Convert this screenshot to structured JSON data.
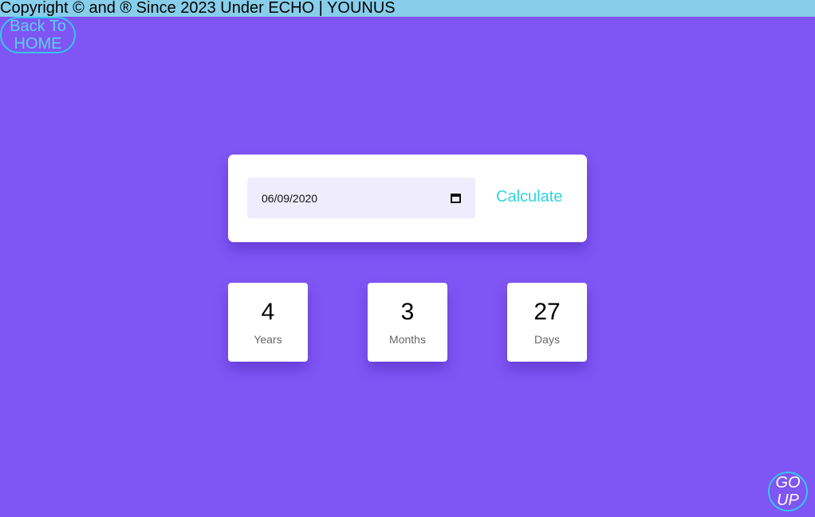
{
  "footer": {
    "copyright": "Copyright © and ® Since 2023 Under ECHO | YOUNUS"
  },
  "nav": {
    "back_line1": "Back To",
    "back_line2": "HOME"
  },
  "calculator": {
    "date_value": "06/09/2020",
    "calculate_label": "Calculate",
    "icon": "calendar-icon"
  },
  "results": {
    "years": {
      "value": "4",
      "label": "Years"
    },
    "months": {
      "value": "3",
      "label": "Months"
    },
    "days": {
      "value": "27",
      "label": "Days"
    }
  },
  "scroll": {
    "line1": "GO",
    "line2": "UP"
  },
  "colors": {
    "background": "#7f55f4",
    "topbar": "#87ceeb",
    "accent": "#2fd5e0",
    "input_bg": "#efedfd"
  }
}
